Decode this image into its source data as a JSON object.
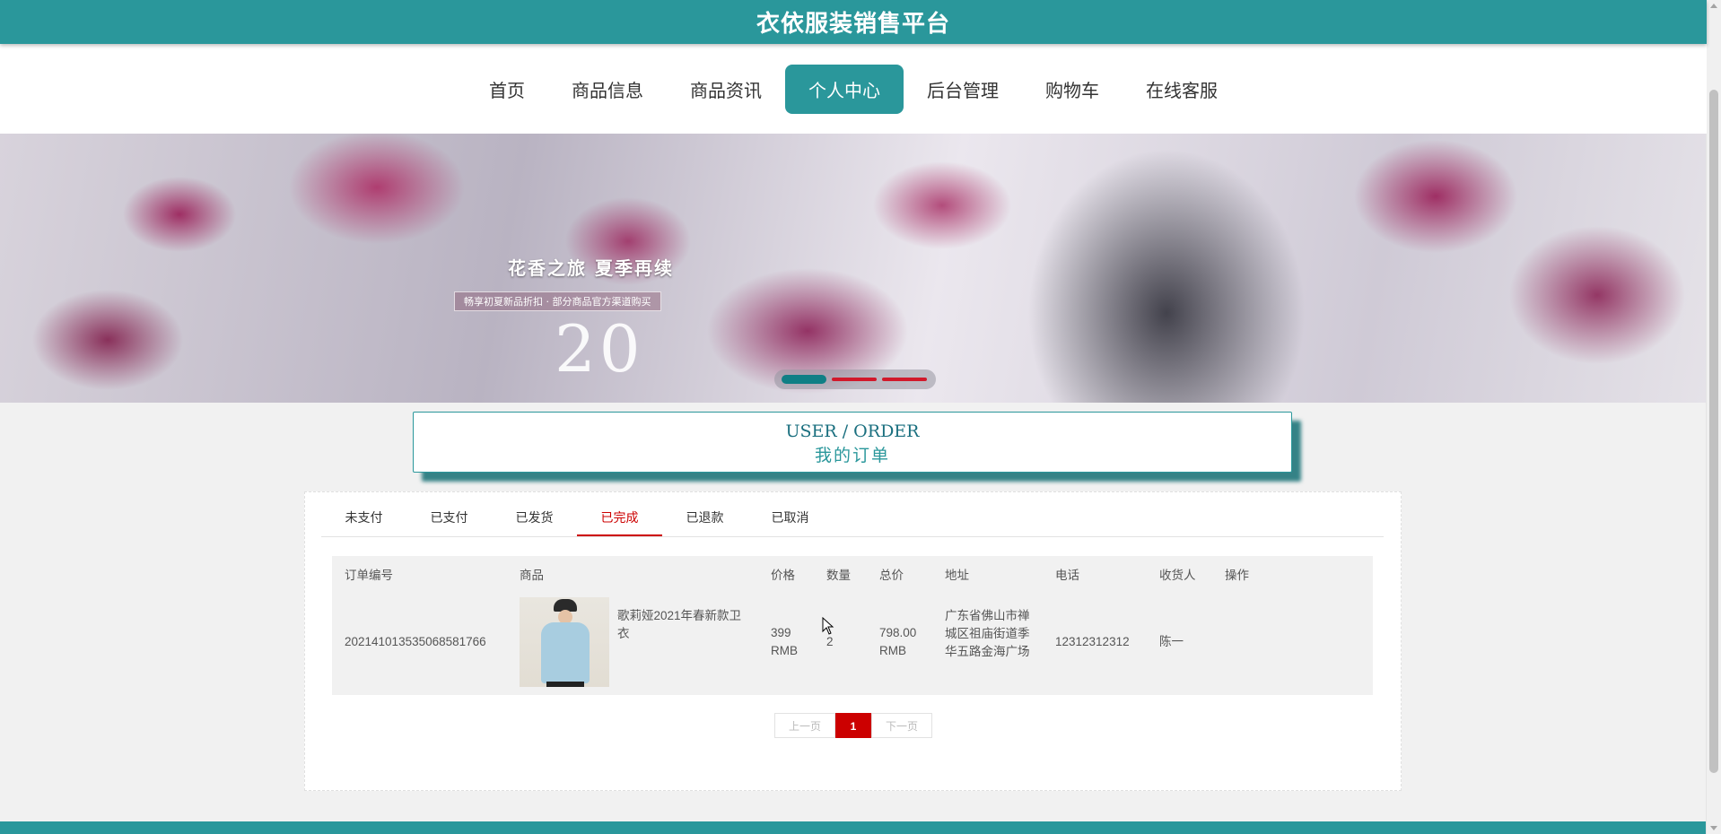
{
  "site": {
    "title": "衣依服装销售平台"
  },
  "nav": {
    "items": [
      {
        "label": "首页",
        "active": false
      },
      {
        "label": "商品信息",
        "active": false
      },
      {
        "label": "商品资讯",
        "active": false
      },
      {
        "label": "个人中心",
        "active": true
      },
      {
        "label": "后台管理",
        "active": false
      },
      {
        "label": "购物车",
        "active": false
      },
      {
        "label": "在线客服",
        "active": false
      }
    ]
  },
  "banner": {
    "headline": "花香之旅 夏季再续",
    "sub": "畅享初夏新品折扣 · 部分商品官方渠道购买",
    "big": "20",
    "slides": 3,
    "current_slide": 1
  },
  "section": {
    "title_en": "USER / ORDER",
    "title_cn": "我的订单"
  },
  "tabs": [
    {
      "label": "未支付",
      "active": false
    },
    {
      "label": "已支付",
      "active": false
    },
    {
      "label": "已发货",
      "active": false
    },
    {
      "label": "已完成",
      "active": true
    },
    {
      "label": "已退款",
      "active": false
    },
    {
      "label": "已取消",
      "active": false
    }
  ],
  "table": {
    "headers": [
      "订单编号",
      "商品",
      "价格",
      "数量",
      "总价",
      "地址",
      "电话",
      "收货人",
      "操作"
    ],
    "rows": [
      {
        "order_no": "202141013535068581766",
        "product": "歌莉娅2021年春新款卫衣",
        "price": "399 RMB",
        "qty": "2",
        "total": "798.00 RMB",
        "address": "广东省佛山市禅城区祖庙街道季华五路金海广场",
        "phone": "12312312312",
        "receiver": "陈一",
        "action": ""
      }
    ]
  },
  "pager": {
    "prev": "上一页",
    "current": "1",
    "next": "下一页"
  },
  "colors": {
    "primary": "#2a979b",
    "accent": "#cc0000"
  }
}
